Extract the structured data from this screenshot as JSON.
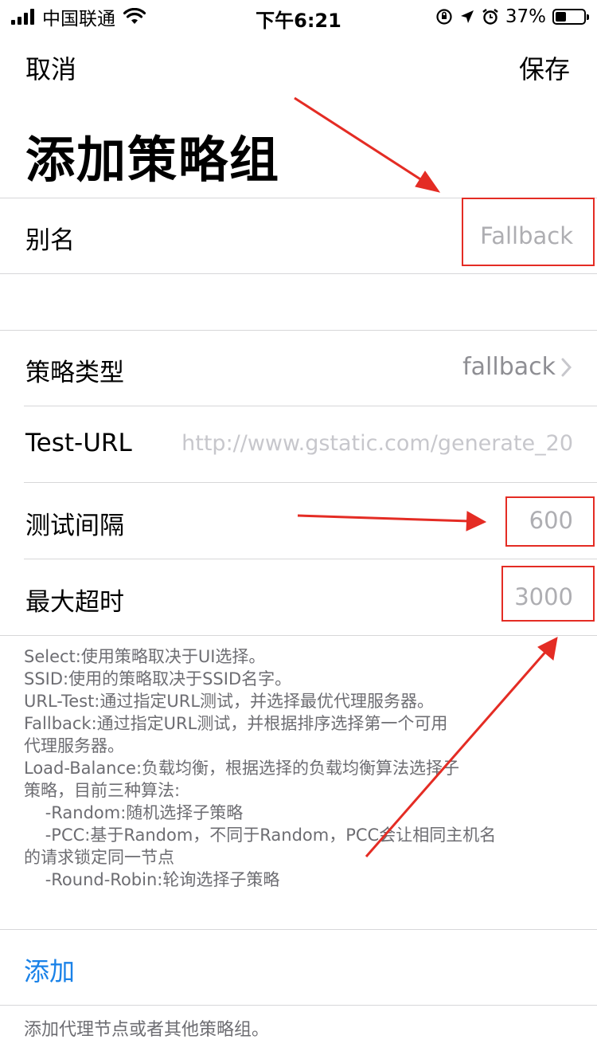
{
  "status_bar": {
    "carrier": "中国联通",
    "time": "下午6:21",
    "battery_percent": "37%",
    "battery_level": 0.37,
    "icons": [
      "signal-icon",
      "wifi-icon",
      "rotation-lock-icon",
      "location-icon",
      "alarm-icon",
      "battery-icon"
    ]
  },
  "nav": {
    "cancel_label": "取消",
    "save_label": "保存"
  },
  "title": "添加策略组",
  "alias": {
    "label": "别名",
    "placeholder": "Fallback"
  },
  "policy_type": {
    "label": "策略类型",
    "value": "fallback"
  },
  "test_url": {
    "label": "Test-URL",
    "placeholder": "http://www.gstatic.com/generate_20"
  },
  "test_interval": {
    "label": "测试间隔",
    "value": "600"
  },
  "max_timeout": {
    "label": "最大超时",
    "value": "3000"
  },
  "description": "Select:使用策略取决于UI选择。\nSSID:使用的策略取决于SSID名字。\nURL-Test:通过指定URL测试，并选择最优代理服务器。\nFallback:通过指定URL测试，并根据排序选择第一个可用\n代理服务器。\nLoad-Balance:负载均衡，根据选择的负载均衡算法选择子\n策略，目前三种算法:\n    -Random:随机选择子策略\n    -PCC:基于Random，不同于Random，PCC会让相同主机名\n的请求锁定同一节点\n    -Round-Robin:轮询选择子策略",
  "add": {
    "label": "添加"
  },
  "footer_note": "添加代理节点或者其他策略组。",
  "colors": {
    "accent": "#1a82e8",
    "annotation_red": "#e42c24",
    "secondary_text": "#8e8e93"
  }
}
